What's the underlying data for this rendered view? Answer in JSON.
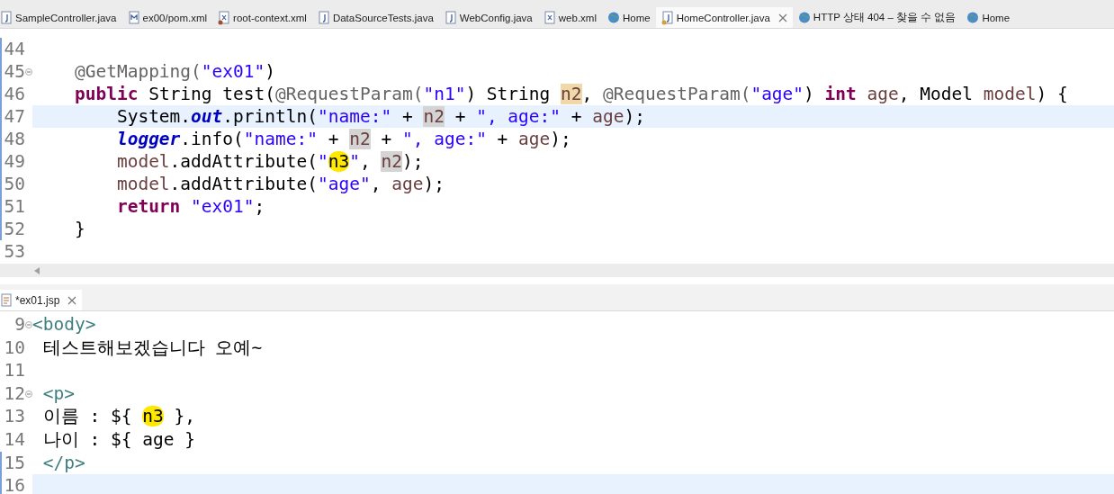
{
  "editor_tabs": [
    {
      "label": "SampleController.java",
      "kind": "java",
      "selected": false
    },
    {
      "label": "ex00/pom.xml",
      "kind": "maven",
      "selected": false
    },
    {
      "label": "root-context.xml",
      "kind": "beans",
      "selected": false
    },
    {
      "label": "DataSourceTests.java",
      "kind": "java",
      "selected": false
    },
    {
      "label": "WebConfig.java",
      "kind": "java",
      "selected": false
    },
    {
      "label": "web.xml",
      "kind": "xml",
      "selected": false
    },
    {
      "label": "Home",
      "kind": "web",
      "selected": false
    },
    {
      "label": "HomeController.java",
      "kind": "bean",
      "selected": true
    },
    {
      "label": "HTTP 상태 404 – 찾을 수 없음",
      "kind": "web",
      "selected": false
    },
    {
      "label": "Home",
      "kind": "web",
      "selected": false
    }
  ],
  "java_editor": {
    "lines": [
      {
        "number": "44",
        "kind": "blank",
        "changed": true,
        "current": false,
        "foldable": false
      },
      {
        "number": "45",
        "kind": "member",
        "changed": true,
        "current": false,
        "foldable": true,
        "tokens": [
          {
            "text": "@GetMapping(",
            "kind": "annotation"
          },
          {
            "text": "\"ex01\"",
            "kind": "string"
          },
          {
            "text": ")",
            "kind": "plain"
          }
        ]
      },
      {
        "number": "46",
        "kind": "member",
        "changed": true,
        "current": false,
        "foldable": false,
        "tokens": [
          {
            "text": "public",
            "kind": "keyword"
          },
          {
            "text": " String test(",
            "kind": "plain"
          },
          {
            "text": "@RequestParam(",
            "kind": "annotation"
          },
          {
            "text": "\"n1\"",
            "kind": "string"
          },
          {
            "text": ") String ",
            "kind": "plain"
          },
          {
            "text": "n2",
            "kind": "declaration"
          },
          {
            "text": ", ",
            "kind": "plain"
          },
          {
            "text": "@RequestParam(",
            "kind": "annotation"
          },
          {
            "text": "\"age\"",
            "kind": "string"
          },
          {
            "text": ") ",
            "kind": "plain"
          },
          {
            "text": "int",
            "kind": "keyword"
          },
          {
            "text": " age",
            "kind": "variable"
          },
          {
            "text": ", Model ",
            "kind": "plain"
          },
          {
            "text": "model",
            "kind": "variable"
          },
          {
            "text": ") {",
            "kind": "plain"
          }
        ]
      },
      {
        "number": "47",
        "kind": "statement",
        "changed": true,
        "current": true,
        "foldable": false,
        "tokens": [
          {
            "text": "System.",
            "kind": "plain"
          },
          {
            "text": "out",
            "kind": "static"
          },
          {
            "text": ".println(",
            "kind": "plain"
          },
          {
            "text": "\"name:\"",
            "kind": "string"
          },
          {
            "text": " + ",
            "kind": "plain"
          },
          {
            "text": "n2",
            "kind": "occurrence"
          },
          {
            "text": " + ",
            "kind": "plain"
          },
          {
            "text": "\", age:\"",
            "kind": "string"
          },
          {
            "text": " + ",
            "kind": "plain"
          },
          {
            "text": "age",
            "kind": "variable"
          },
          {
            "text": ");",
            "kind": "plain"
          }
        ]
      },
      {
        "number": "48",
        "kind": "statement",
        "changed": true,
        "current": false,
        "foldable": false,
        "tokens": [
          {
            "text": "logger",
            "kind": "static"
          },
          {
            "text": ".info(",
            "kind": "plain"
          },
          {
            "text": "\"name:\"",
            "kind": "string"
          },
          {
            "text": " + ",
            "kind": "plain"
          },
          {
            "text": "n2",
            "kind": "occurrence"
          },
          {
            "text": " + ",
            "kind": "plain"
          },
          {
            "text": "\", age:\"",
            "kind": "string"
          },
          {
            "text": " + ",
            "kind": "plain"
          },
          {
            "text": "age",
            "kind": "variable"
          },
          {
            "text": ");",
            "kind": "plain"
          }
        ]
      },
      {
        "number": "49",
        "kind": "statement",
        "changed": true,
        "current": false,
        "foldable": false,
        "tokens": [
          {
            "text": "model",
            "kind": "variable"
          },
          {
            "text": ".addAttribute(",
            "kind": "plain"
          },
          {
            "text": "\"",
            "kind": "string"
          },
          {
            "text": "n3",
            "kind": "marked"
          },
          {
            "text": "\"",
            "kind": "string"
          },
          {
            "text": ", ",
            "kind": "plain"
          },
          {
            "text": "n2",
            "kind": "occurrence"
          },
          {
            "text": ");",
            "kind": "plain"
          }
        ]
      },
      {
        "number": "50",
        "kind": "statement",
        "changed": true,
        "current": false,
        "foldable": false,
        "tokens": [
          {
            "text": "model",
            "kind": "variable"
          },
          {
            "text": ".addAttribute(",
            "kind": "plain"
          },
          {
            "text": "\"age\"",
            "kind": "string"
          },
          {
            "text": ", ",
            "kind": "plain"
          },
          {
            "text": "age",
            "kind": "variable"
          },
          {
            "text": ");",
            "kind": "plain"
          }
        ]
      },
      {
        "number": "51",
        "kind": "statement",
        "changed": true,
        "current": false,
        "foldable": false,
        "tokens": [
          {
            "text": "return",
            "kind": "keyword"
          },
          {
            "text": " \"ex01\"",
            "kind": "string"
          },
          {
            "text": ";",
            "kind": "plain"
          }
        ]
      },
      {
        "number": "52",
        "kind": "member",
        "changed": true,
        "current": false,
        "foldable": false,
        "tokens": [
          {
            "text": "}",
            "kind": "plain"
          }
        ]
      },
      {
        "number": "53",
        "kind": "blank",
        "changed": false,
        "current": false,
        "foldable": false
      }
    ]
  },
  "jsp_tab": {
    "label": "*ex01.jsp",
    "kind": "jsp",
    "selected": true
  },
  "jsp_editor": {
    "lines": [
      {
        "number": "9",
        "kind": "root",
        "changed": false,
        "current": false,
        "foldable": true,
        "tokens": [
          {
            "text": "<body>",
            "kind": "tag"
          }
        ]
      },
      {
        "number": "10",
        "kind": "child",
        "changed": false,
        "current": false,
        "foldable": false,
        "tokens": [
          {
            "text": "테스트해보겠습니다 오예~",
            "kind": "plain"
          }
        ]
      },
      {
        "number": "11",
        "kind": "blank",
        "changed": false,
        "current": false,
        "foldable": false
      },
      {
        "number": "12",
        "kind": "child",
        "changed": false,
        "current": false,
        "foldable": true,
        "tokens": [
          {
            "text": "<p>",
            "kind": "tag"
          }
        ]
      },
      {
        "number": "13",
        "kind": "child",
        "changed": false,
        "current": false,
        "foldable": false,
        "tokens": [
          {
            "text": "이름 : ${ ",
            "kind": "plain"
          },
          {
            "text": "n3",
            "kind": "marked"
          },
          {
            "text": " },",
            "kind": "plain"
          }
        ]
      },
      {
        "number": "14",
        "kind": "child",
        "changed": false,
        "current": false,
        "foldable": false,
        "tokens": [
          {
            "text": "나이 : ${ age }",
            "kind": "plain"
          }
        ]
      },
      {
        "number": "15",
        "kind": "child",
        "changed": true,
        "current": false,
        "foldable": false,
        "tokens": [
          {
            "text": "</p>",
            "kind": "tag"
          }
        ]
      },
      {
        "number": "16",
        "kind": "blank",
        "changed": true,
        "current": true,
        "foldable": false
      }
    ]
  }
}
